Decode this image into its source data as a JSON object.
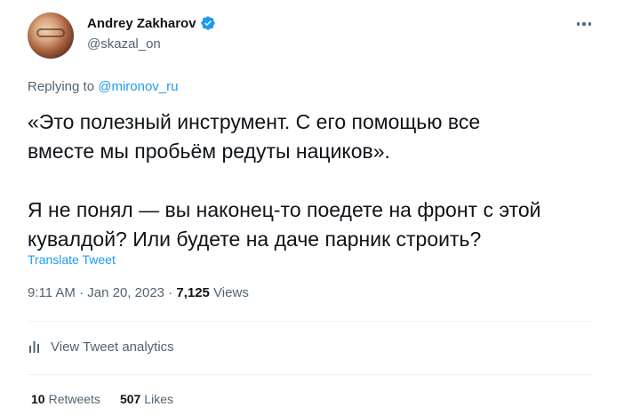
{
  "author": {
    "display_name": "Andrey Zakharov",
    "handle": "@skazal_on",
    "verified_icon": "verified-badge-icon"
  },
  "reply": {
    "prefix": "Replying to",
    "mention": "@mironov_ru"
  },
  "tweet": {
    "text": "«Это полезный инструмент. С его помощью все\nвместе мы пробьём редуты нациков».\n\nЯ не понял — вы наконец-то поедете на фронт с этой\nкувалдой? Или будете на даче парник строить?",
    "translate_label": "Translate Tweet"
  },
  "meta": {
    "time": "9:11 AM",
    "separator1": " · ",
    "date": "Jan 20, 2023",
    "separator2": " · ",
    "views_count": "7,125",
    "views_label": " Views"
  },
  "analytics": {
    "label": "View Tweet analytics",
    "icon": "analytics-bar-icon"
  },
  "stats": {
    "retweets_count": "10",
    "retweets_label": "Retweets",
    "likes_count": "507",
    "likes_label": "Likes"
  },
  "colors": {
    "accent": "#1d9bf0",
    "secondary_text": "#536471",
    "primary_text": "#0f1419",
    "divider": "#eff3f4"
  }
}
